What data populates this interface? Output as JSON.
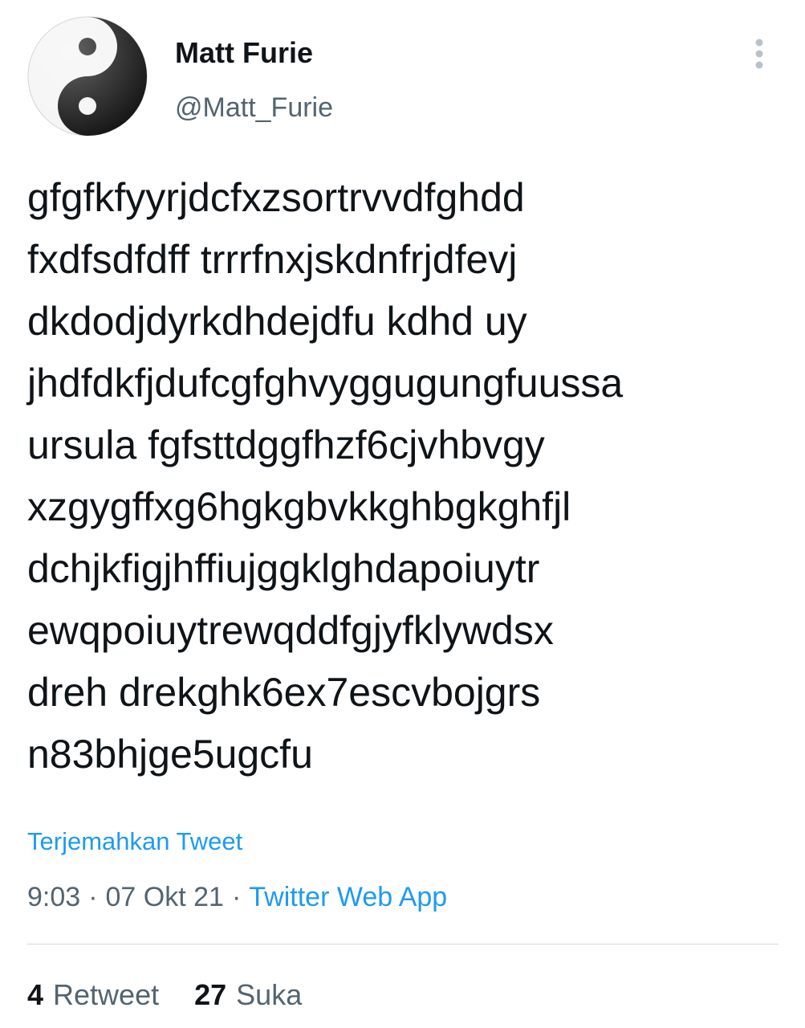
{
  "author": {
    "name": "Matt Furie",
    "handle": "@Matt_Furie",
    "avatar_icon": "yin-yang-icon"
  },
  "tweet": {
    "text": "gfgfkfyyrjdcfxzsortrvvdfghdd\nfxdfsdfdff trrrfnxjskdnfrjdfevj\ndkdodjdyrkdhdejdfu kdhd uy\njhdfdkfjdufcgfghvyggugungfuussa\nursula fgfsttdggfhzf6cjvhbvgy\nxzgygffxg6hgkgbvkkghbgkghfjl\ndchjkfigjhffiujggklghdapoiuytr\newqpoiuytrewqddfgjyfklywdsx\ndreh drekghk6ex7escvbojgrs\nn83bhjge5ugcfu",
    "translate_label": "Terjemahkan Tweet"
  },
  "meta": {
    "time": "9:03",
    "date": "07 Okt 21",
    "separator": "·",
    "source": "Twitter Web App"
  },
  "stats": {
    "retweet_count": "4",
    "retweet_label": "Retweet",
    "like_count": "27",
    "like_label": "Suka"
  },
  "colors": {
    "text": "#0f1419",
    "secondary": "#536471",
    "link": "#1d9bf0",
    "divider": "#cfd9de"
  }
}
